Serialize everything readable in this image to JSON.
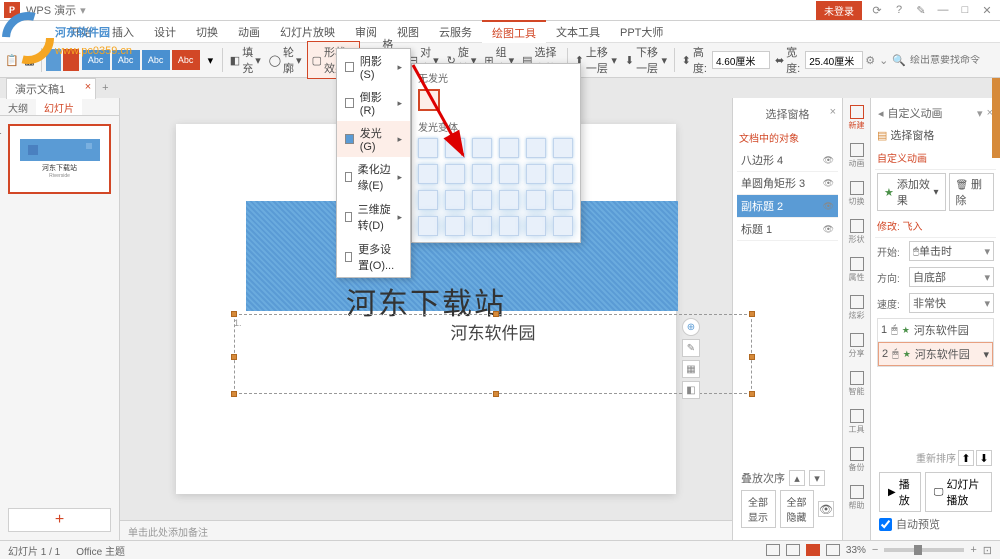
{
  "titlebar": {
    "app": "WPS 演示",
    "login": "未登录"
  },
  "menu": {
    "items": [
      "开始",
      "插入",
      "设计",
      "切换",
      "动画",
      "幻灯片放映",
      "审阅",
      "视图",
      "云服务",
      "绘图工具",
      "文本工具",
      "PPT大师"
    ],
    "active": 9
  },
  "ribbon": {
    "fill": "填充",
    "outline": "轮廓",
    "effect": "形状效果",
    "fmt": "格式刷",
    "align": "对齐",
    "rotate": "旋转",
    "group": "组合",
    "select": "选择窗格",
    "up": "上移一层",
    "down": "下移一层",
    "height_label": "高度:",
    "height": "4.60厘米",
    "width_label": "宽度:",
    "width": "25.40厘米",
    "search_placeholder": "绘出意要找命令",
    "styles": [
      "Abc",
      "Abc",
      "Abc",
      "Abc"
    ]
  },
  "doctab": "演示文稿1",
  "leftpanel": {
    "tabs": [
      "大纲",
      "幻灯片"
    ],
    "active": 1,
    "thumb_title": "河东下载站",
    "thumb_sub": "Riverside"
  },
  "slide": {
    "title": "河东下载站",
    "textbox": "河东软件园",
    "cursor": "1."
  },
  "dropdown": {
    "items": [
      {
        "label": "阴影(S)",
        "arrow": true
      },
      {
        "label": "倒影(R)",
        "arrow": true
      },
      {
        "label": "发光(G)",
        "arrow": true,
        "hl": true
      },
      {
        "label": "柔化边缘(E)",
        "arrow": true
      },
      {
        "label": "三维旋转(D)",
        "arrow": true
      },
      {
        "label": "更多设置(O)...",
        "arrow": false
      }
    ]
  },
  "glow": {
    "none": "无发光",
    "variants": "发光变体"
  },
  "notes": "单击此处添加备注",
  "selection": {
    "title": "选择窗格",
    "section": "文档中的对象",
    "items": [
      {
        "label": "八边形 4"
      },
      {
        "label": "单圆角矩形 3"
      },
      {
        "label": "副标题 2",
        "sel": true
      },
      {
        "label": "标题 1"
      }
    ],
    "stack": "叠放次序",
    "show_all": "全部显示",
    "hide_all": "全部隐藏"
  },
  "sidebar": {
    "items": [
      "新建",
      "动画",
      "切换",
      "形状",
      "属性",
      "炫彩",
      "分享",
      "智能",
      "工具",
      "备份",
      "帮助"
    ]
  },
  "anim": {
    "title": "自定义动画",
    "sel_pane": "选择窗格",
    "custom": "自定义动画",
    "add": "添加效果",
    "del": "删除",
    "rm": "删除",
    "modify": "修改: 飞入",
    "start_label": "开始:",
    "start": "单击时",
    "dir_label": "方向:",
    "dir": "自底部",
    "speed_label": "速度:",
    "speed": "非常快",
    "list": [
      {
        "n": "1",
        "label": "河东软件园"
      },
      {
        "n": "2",
        "label": "河东软件园",
        "sel": true
      }
    ],
    "reorder": "重新排序",
    "play": "播放",
    "slideshow": "幻灯片播放",
    "auto": "自动预览"
  },
  "status": {
    "slide": "幻灯片 1 / 1",
    "theme": "Office 主题",
    "zoom": "33%"
  },
  "watermark": {
    "title": "河东软件园",
    "url": "www.pc0359.cn"
  }
}
